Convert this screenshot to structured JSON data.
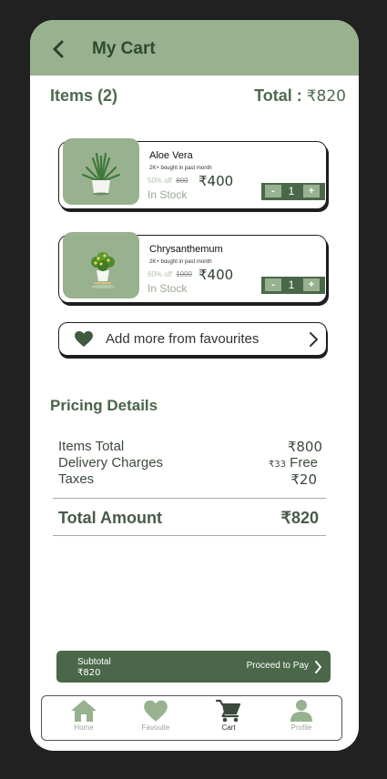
{
  "header": {
    "title": "My Cart"
  },
  "summary": {
    "items_label": "Items (2)",
    "total_label": "Total :",
    "total_value": "₹820"
  },
  "cart_items": [
    {
      "name": "Aloe Vera",
      "bought": "2K+ bought in past month",
      "discount": "50% off",
      "original_price": "800",
      "price": "₹400",
      "stock": "In Stock",
      "quantity": "1"
    },
    {
      "name": "Chrysanthemum",
      "bought": "2K+ bought in past month",
      "discount": "60% off",
      "original_price": "1000",
      "price": "₹400",
      "stock": "In Stock",
      "quantity": "1"
    }
  ],
  "stepper": {
    "minus": "-",
    "plus": "+"
  },
  "favourites": {
    "label": "Add more from favourites"
  },
  "pricing": {
    "title": "Pricing Details",
    "items_total_label": "Items Total",
    "items_total_value": "₹800",
    "delivery_label": "Delivery Charges",
    "delivery_strike": "₹33",
    "delivery_value": "Free",
    "taxes_label": "Taxes",
    "taxes_value": "₹20",
    "total_amount_label": "Total Amount",
    "total_amount_value": "₹820"
  },
  "checkout": {
    "subtotal_label": "Subtotal",
    "subtotal_value": "₹820",
    "proceed_label": "Proceed to Pay"
  },
  "nav": {
    "home": "Home",
    "favourite": "Favouite",
    "cart": "Cart",
    "profile": "Profile"
  },
  "colors": {
    "brand_light": "#98b18f",
    "brand_dark": "#4a6849",
    "background": "#212121"
  },
  "icons": {
    "back": "chevron-left-icon",
    "heart": "heart-icon",
    "chevron": "chevron-right-icon",
    "home": "home-icon",
    "favourite": "heart-icon",
    "cart": "cart-icon",
    "profile": "user-icon"
  }
}
